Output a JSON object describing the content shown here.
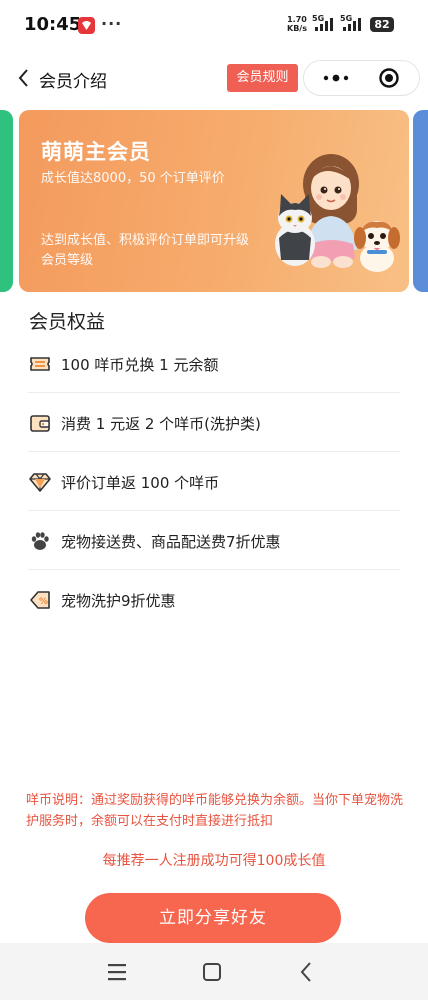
{
  "status_bar": {
    "time": "10:45",
    "more": "···",
    "net_speed_value": "1.70",
    "net_speed_unit": "KB/s",
    "signal_1_label": "5G",
    "signal_2_label": "5G",
    "battery": "82"
  },
  "nav": {
    "title": "会员介绍",
    "rules_button": "会员规则"
  },
  "card": {
    "title": "萌萌主会员",
    "requirement": "成长值达8000，50 个订单评价",
    "description": "达到成长值、积极评价订单即可升级会员等级",
    "accent": "#f49a5d",
    "left_peek_color": "#2fc27e",
    "right_peek_color": "#5b8ed8"
  },
  "benefits": {
    "title": "会员权益",
    "items": [
      {
        "icon": "ticket-icon",
        "label": "100 咩币兑换 1 元余额"
      },
      {
        "icon": "wallet-icon",
        "label": "消费 1 元返 2 个咩币(洗护类)"
      },
      {
        "icon": "diamond-icon",
        "label": "评价订单返 100 个咩币"
      },
      {
        "icon": "paw-icon",
        "label": "宠物接送费、商品配送费7折优惠"
      },
      {
        "icon": "discount-tag-icon",
        "label": "宠物洗护9折优惠"
      }
    ]
  },
  "footer": {
    "note": "咩币说明：通过奖励获得的咩币能够兑换为余额。当你下单宠物洗护服务时，余额可以在支付时直接进行抵扣",
    "referral": "每推荐一人注册成功可得100成长值",
    "share_button": "立即分享好友",
    "accent": "#f7664f"
  }
}
